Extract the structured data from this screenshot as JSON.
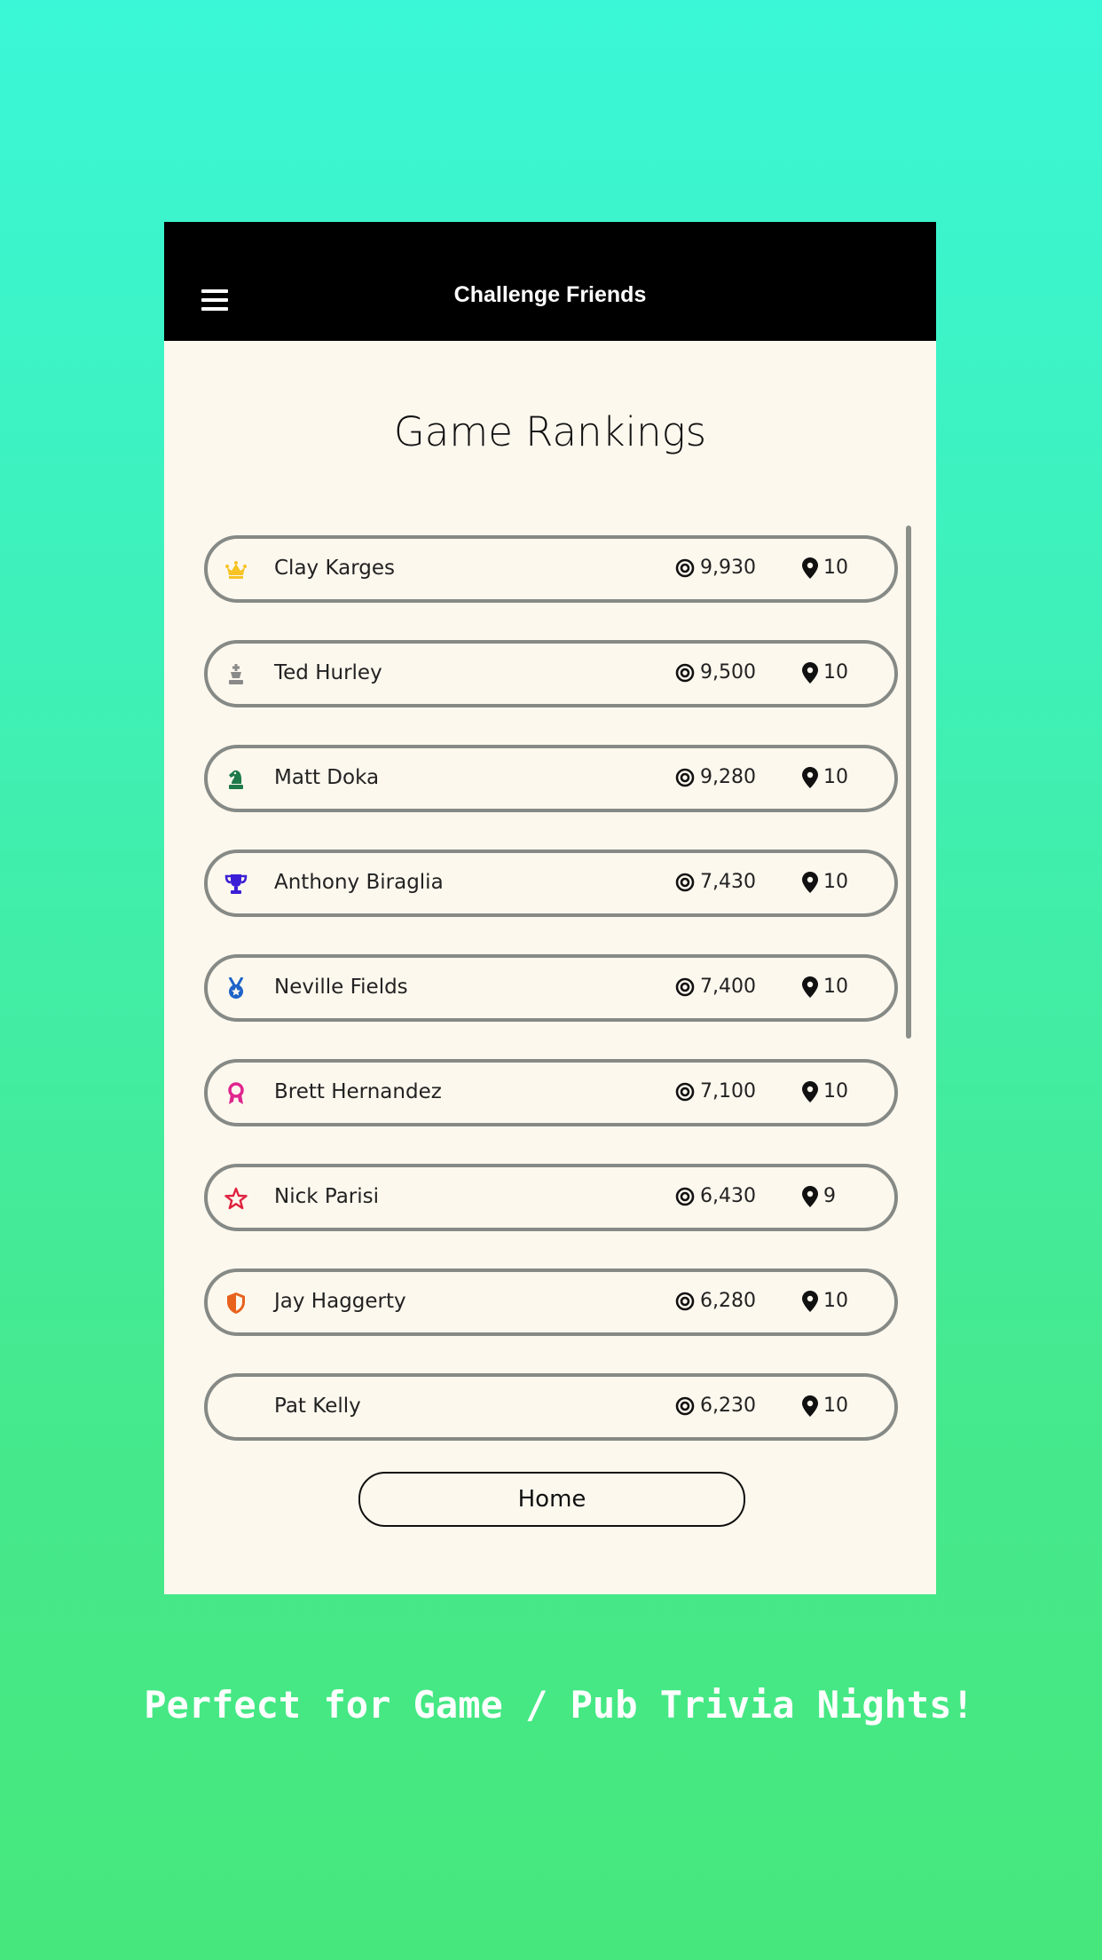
{
  "appbar": {
    "title": "Challenge Friends",
    "menu_icon": "hamburger-menu-icon"
  },
  "page_title": "Game Rankings",
  "players": [
    {
      "name": "Clay Karges",
      "score": "9,930",
      "level": "10",
      "badge": "crown-icon",
      "badge_color": "#f7c325"
    },
    {
      "name": "Ted Hurley",
      "score": "9,500",
      "level": "10",
      "badge": "chess-king-icon",
      "badge_color": "#8a8a8a"
    },
    {
      "name": "Matt Doka",
      "score": "9,280",
      "level": "10",
      "badge": "chess-knight-icon",
      "badge_color": "#1f7a4a"
    },
    {
      "name": "Anthony Biraglia",
      "score": "7,430",
      "level": "10",
      "badge": "trophy-icon",
      "badge_color": "#3b1fd6"
    },
    {
      "name": "Neville Fields",
      "score": "7,400",
      "level": "10",
      "badge": "medal-icon",
      "badge_color": "#1e63c8"
    },
    {
      "name": "Brett Hernandez",
      "score": "7,100",
      "level": "10",
      "badge": "ribbon-award-icon",
      "badge_color": "#e0268f"
    },
    {
      "name": "Nick Parisi",
      "score": "6,430",
      "level": "9",
      "badge": "star-outline-icon",
      "badge_color": "#e0223f"
    },
    {
      "name": "Jay Haggerty",
      "score": "6,280",
      "level": "10",
      "badge": "shield-icon",
      "badge_color": "#e8621e"
    },
    {
      "name": "Pat Kelly",
      "score": "6,230",
      "level": "10",
      "badge": "",
      "badge_color": ""
    }
  ],
  "score_icon": "target-icon",
  "level_icon": "map-pin-icon",
  "home_button": "Home",
  "tagline": "Perfect for Game / Pub Trivia Nights!",
  "colors": {
    "accent_gradient_top": "#3af7d7",
    "accent_gradient_bottom": "#46e77c",
    "card_bg": "#fdf8ee",
    "appbar_bg": "#000000"
  }
}
